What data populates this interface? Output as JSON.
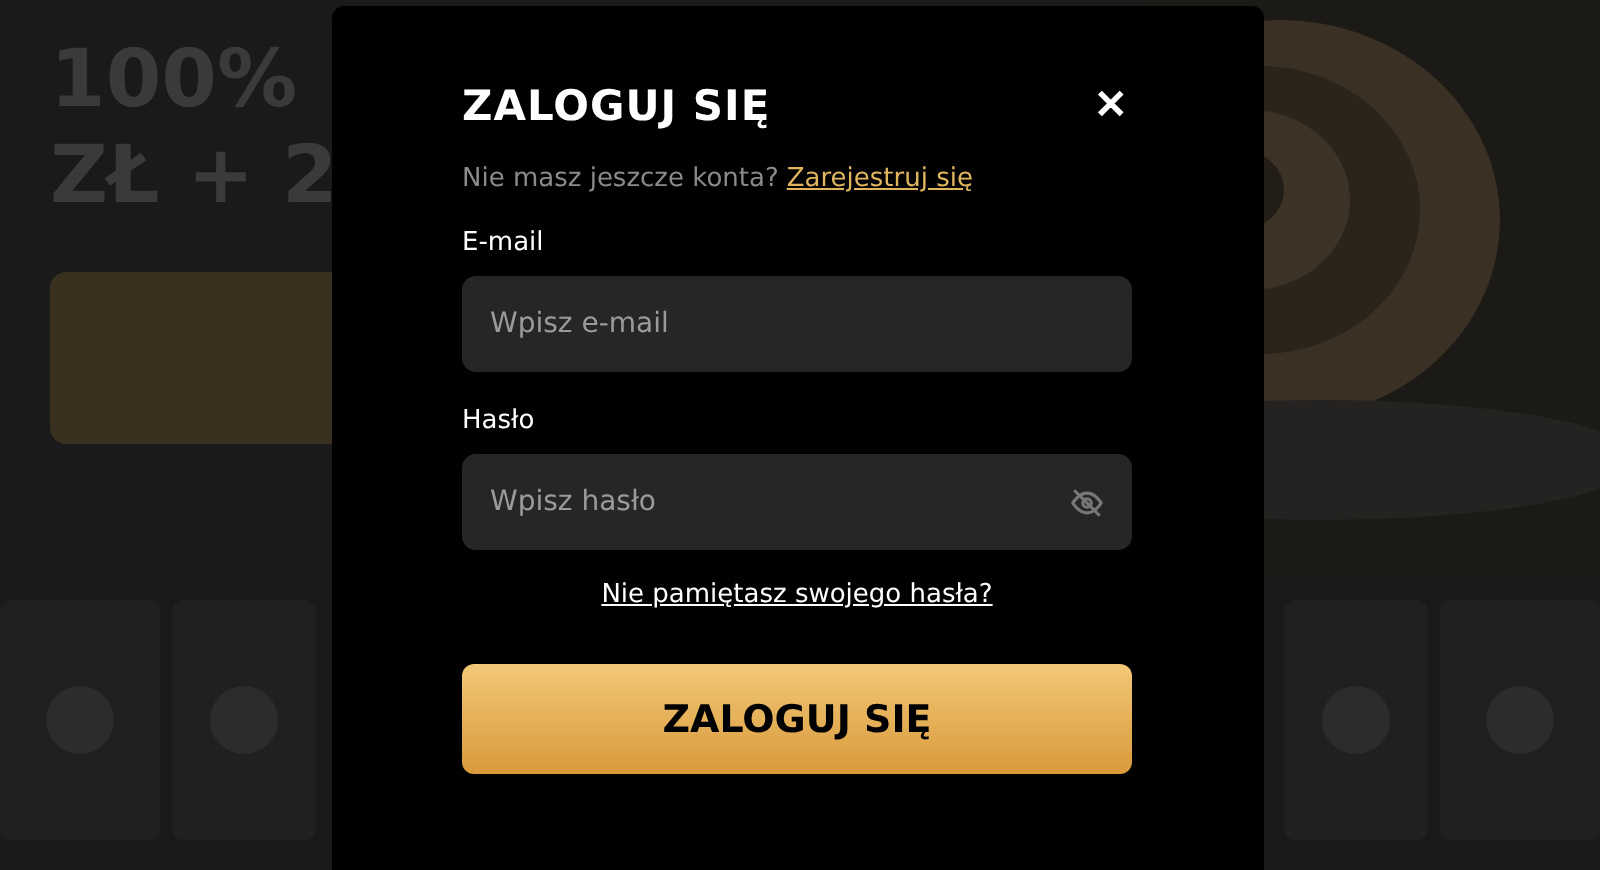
{
  "background": {
    "hero_lines": [
      "100%",
      "ZŁ + 2"
    ],
    "tiles": [
      {
        "kind": "icon"
      },
      {
        "kind": "icon"
      },
      {
        "kind": "icon"
      },
      {
        "kind": "icon"
      }
    ]
  },
  "dialog": {
    "title": "ZALOGUJ SIĘ",
    "close": "✕",
    "register_prompt": "Nie masz jeszcze konta?",
    "register_link": "Zarejestruj się",
    "fields": [
      {
        "label": "E-mail",
        "placeholder": "Wpisz e-mail",
        "kind": "email"
      },
      {
        "label": "Hasło",
        "placeholder": "Wpisz hasło",
        "kind": "password"
      }
    ],
    "forgot_link": "Nie pamiętasz swojego hasła?",
    "submit": "ZALOGUJ SIĘ"
  }
}
